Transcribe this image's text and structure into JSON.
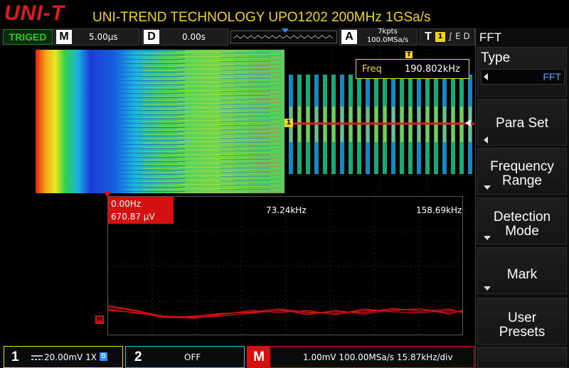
{
  "header": {
    "logo": "UNI-T",
    "title": "UNI-TREND TECHNOLOGY UPO1202 200MHz 1GSa/s"
  },
  "status_bar": {
    "trigger_state": "TRIGED",
    "timebase_label": "M",
    "timebase_value": "5.00µs",
    "delay_label": "D",
    "delay_value": "0.00s",
    "acquire_label": "A",
    "acquire_points": "7kpts",
    "acquire_rate": "100.0MSa/s",
    "trigger_label": "T",
    "trigger_source": "1",
    "trigger_edge": "∫ E D"
  },
  "waveform": {
    "trigger_marker": "T",
    "channel_marker": "1",
    "freq_measure_label": "Freq",
    "freq_measure_value": "190.802kHz"
  },
  "fft": {
    "cursor_freq": "0.00Hz",
    "cursor_amp": "670.87 µV",
    "center_freq": "73.24kHz",
    "end_freq": "158.69kHz",
    "math_marker": "M"
  },
  "right_panel": {
    "title": "FFT",
    "type_label": "Type",
    "type_value": "FFT",
    "buttons": [
      {
        "label_line1": "Para Set",
        "label_line2": ""
      },
      {
        "label_line1": "Frequency",
        "label_line2": "Range"
      },
      {
        "label_line1": "Detection",
        "label_line2": "Mode"
      },
      {
        "label_line1": "Mark",
        "label_line2": ""
      },
      {
        "label_line1": "User",
        "label_line2": "Presets"
      }
    ]
  },
  "bottom_bar": {
    "ch1_num": "1",
    "ch1_value": "20.00mV  1X",
    "ch1_bw": "B",
    "ch2_num": "2",
    "ch2_value": "OFF",
    "math_num": "M",
    "math_value": "1.00mV  100.00MSa/s  15.87kHz/div"
  },
  "colors": {
    "ch1": "#f2d21b",
    "ch2": "#27c4e6",
    "math": "#d41010",
    "trigger_ok": "#22cc22",
    "accent_blue": "#2f8cff"
  }
}
